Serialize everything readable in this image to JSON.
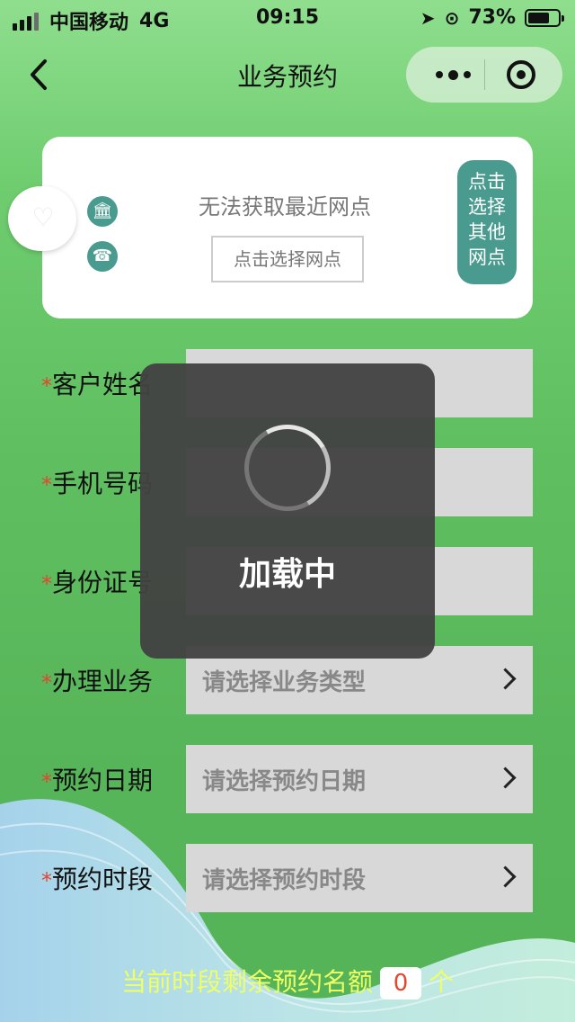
{
  "status_bar": {
    "carrier": "中国移动",
    "network": "4G",
    "time": "09:15",
    "battery": "73%",
    "battery_level": 0.73
  },
  "nav": {
    "title": "业务预约",
    "back_icon": "chevron-left-icon",
    "menu_icon": "more-dots-icon",
    "close_icon": "target-icon"
  },
  "branch_card": {
    "status_text": "无法获取最近网点",
    "select_button": "点击选择网点",
    "other_button": "点击\n选择\n其他\n网点",
    "icons": [
      "bank-icon",
      "phone-icon"
    ]
  },
  "form": {
    "rows": [
      {
        "star": "*",
        "label": "客户姓名",
        "placeholder": ""
      },
      {
        "star": "*",
        "label": "手机号码",
        "placeholder": ""
      },
      {
        "star": "*",
        "label": "身份证号",
        "placeholder": ""
      },
      {
        "star": "*",
        "label": "办理业务",
        "placeholder": "请选择业务类型"
      },
      {
        "star": "*",
        "label": "预约日期",
        "placeholder": "请选择预约日期"
      },
      {
        "star": "*",
        "label": "预约时段",
        "placeholder": "请选择预约时段"
      }
    ]
  },
  "loading": {
    "text": "加载中"
  },
  "quota": {
    "prefix": "当前时段剩余预约名额",
    "count": "0",
    "suffix": "个"
  },
  "colors": {
    "accent_teal": "#4a9b8f",
    "required_star": "#e2472f",
    "quota_text": "#eeff66"
  }
}
